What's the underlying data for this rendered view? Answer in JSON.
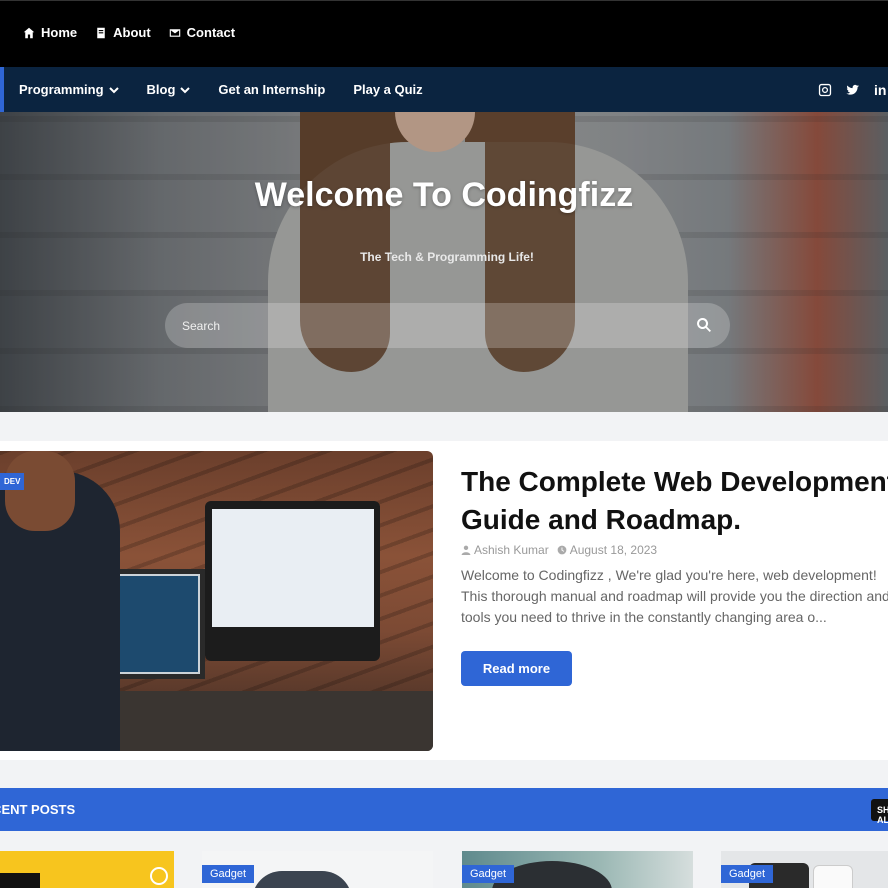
{
  "topbar": {
    "links": [
      {
        "label": "Home",
        "icon": "home-icon"
      },
      {
        "label": "About",
        "icon": "book-icon"
      },
      {
        "label": "Contact",
        "icon": "envelope-icon"
      }
    ]
  },
  "nav": {
    "items": [
      {
        "label": "Programming",
        "dropdown": true
      },
      {
        "label": "Blog",
        "dropdown": true
      },
      {
        "label": "Get an Internship",
        "dropdown": false
      },
      {
        "label": "Play a Quiz",
        "dropdown": false
      }
    ],
    "social": [
      "instagram-icon",
      "twitter-icon",
      "linkedin-icon"
    ],
    "linkedin_text": "in"
  },
  "hero": {
    "title": "Welcome To Codingfizz",
    "tagline": "The Tech & Programming Life!",
    "search_placeholder": "Search"
  },
  "featured": {
    "category": "DEV",
    "title": "The Complete Web Development Guide and Roadmap.",
    "author": "Ashish Kumar",
    "date": "August 18, 2023",
    "excerpt": "Welcome to Codingfizz , We're glad you're here, web development! This thorough manual and roadmap will provide you the direction and tools you need to thrive in the constantly changing area o...",
    "read_more": "Read more"
  },
  "recent": {
    "title": "RECENT POSTS",
    "button": "SHOW ALL",
    "cards": [
      {
        "category": ""
      },
      {
        "category": "Gadget"
      },
      {
        "category": "Gadget"
      },
      {
        "category": "Gadget"
      }
    ]
  },
  "colors": {
    "accent": "#2f66d6",
    "nav_bg": "#0b2440",
    "topbar_bg": "#000000"
  }
}
